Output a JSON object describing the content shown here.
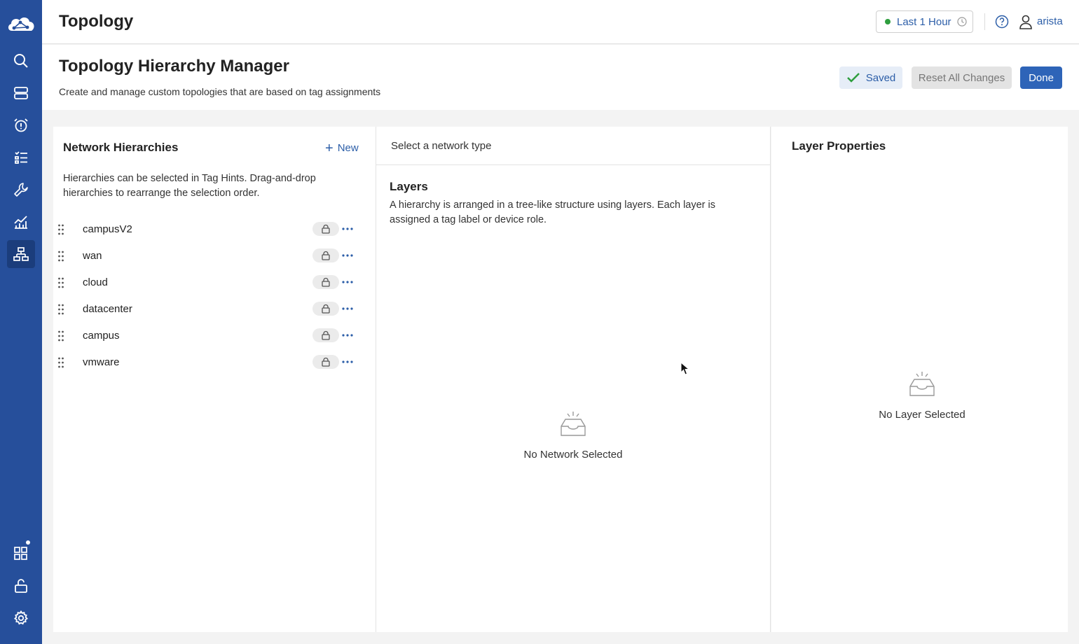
{
  "header": {
    "title": "Topology",
    "time_range": "Last 1 Hour",
    "user": "arista"
  },
  "sidebar": {
    "items": [
      {
        "icon": "search-icon"
      },
      {
        "icon": "devices-icon"
      },
      {
        "icon": "events-alarm-icon"
      },
      {
        "icon": "provisioning-list-icon"
      },
      {
        "icon": "tools-wrench-icon"
      },
      {
        "icon": "dashboards-chart-icon"
      },
      {
        "icon": "topology-icon",
        "active": true
      },
      {
        "icon": "apps-grid-icon"
      },
      {
        "icon": "unlock-icon"
      },
      {
        "icon": "settings-gear-icon"
      }
    ]
  },
  "page": {
    "title": "Topology Hierarchy Manager",
    "subtitle": "Create and manage custom topologies that are based on tag assignments",
    "saved_label": "Saved",
    "reset_label": "Reset All Changes",
    "done_label": "Done"
  },
  "hierarchies": {
    "title": "Network Hierarchies",
    "new_label": "New",
    "hint": "Hierarchies can be selected in Tag Hints. Drag-and-drop hierarchies to rearrange the selection order.",
    "items": [
      "campusV2",
      "wan",
      "cloud",
      "datacenter",
      "campus",
      "vmware"
    ]
  },
  "layers": {
    "network_type_placeholder": "Select a network type",
    "title": "Layers",
    "description": "A hierarchy is arranged in a tree-like structure using layers. Each layer is assigned a tag label or device role.",
    "empty_text": "No Network Selected"
  },
  "layer_properties": {
    "title": "Layer Properties",
    "empty_text": "No Layer Selected"
  },
  "colors": {
    "sidebar": "#264f9b",
    "accent": "#2c5ea8",
    "primary_button": "#2e64b8",
    "status_green": "#2e9e3e"
  }
}
